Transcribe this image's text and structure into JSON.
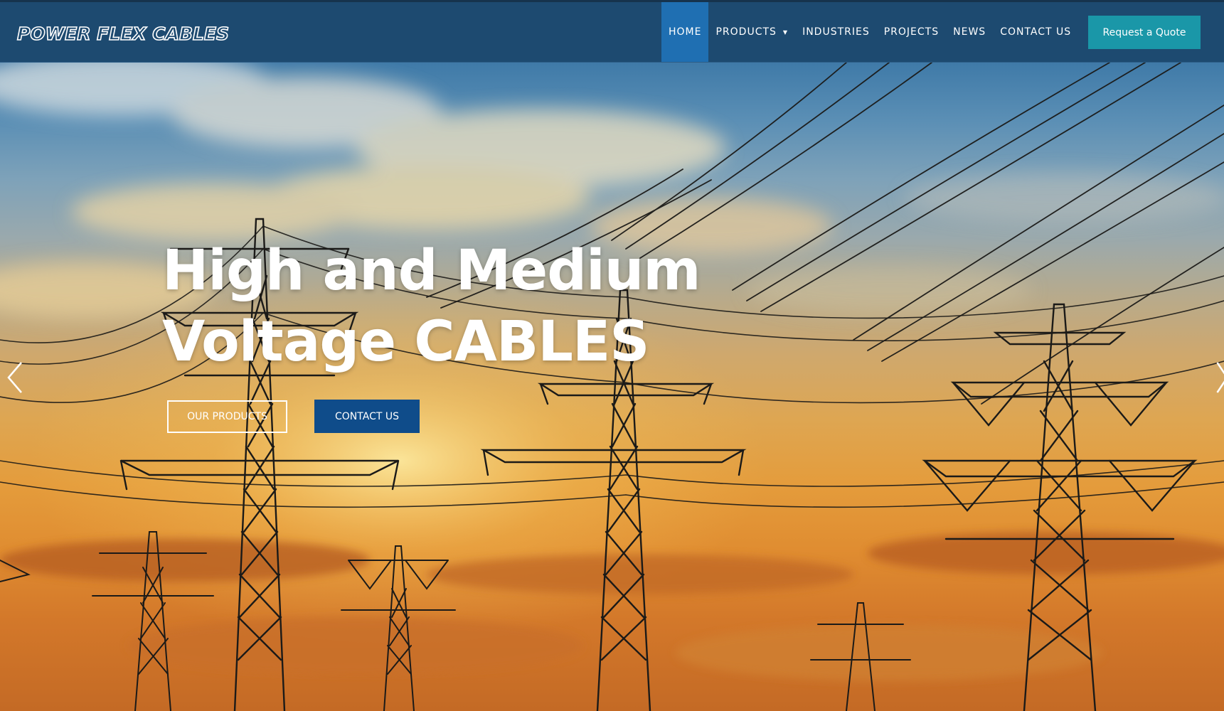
{
  "brand": {
    "logo_text": "POWER FLEX CABLES"
  },
  "nav": {
    "items": [
      {
        "label": "HOME",
        "active": true
      },
      {
        "label": "PRODUCTS",
        "has_dropdown": true
      },
      {
        "label": "INDUSTRIES"
      },
      {
        "label": "PROJECTS"
      },
      {
        "label": "NEWS"
      },
      {
        "label": "CONTACT US"
      }
    ],
    "quote_label": "Request a Quote"
  },
  "hero": {
    "title_line1": "High and Medium",
    "title_line2": "Voltage CABLES",
    "primary_button": "OUR PRODUCTS",
    "secondary_button": "CONTACT US",
    "prev_icon": "chevron-left-icon",
    "next_icon": "chevron-right-icon"
  },
  "colors": {
    "header_bg": "#1d4a70",
    "nav_active": "#1f6fb2",
    "quote_button": "#1a97a8",
    "contact_button": "#0f4c8a"
  }
}
